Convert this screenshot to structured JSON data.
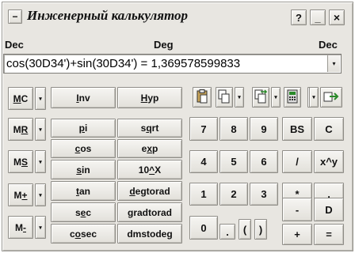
{
  "window": {
    "menu_glyph": "−",
    "title": "Инженерный калькулятор",
    "help_glyph": "?",
    "minimize_glyph": "_",
    "close_glyph": "×"
  },
  "modes": {
    "left": "Dec",
    "center": "Deg",
    "right": "Dec"
  },
  "display": {
    "expression": "cos(30D34')+sin(30D34') = 1,369578599833",
    "dropdown_glyph": "▾"
  },
  "memory": {
    "arrow_glyph": "▾",
    "buttons": [
      {
        "id": "mc",
        "pre": "",
        "u": "M",
        "post": "C"
      },
      {
        "id": "mr",
        "pre": "M",
        "u": "R",
        "post": ""
      },
      {
        "id": "ms",
        "pre": "M",
        "u": "S",
        "post": ""
      },
      {
        "id": "m-plus",
        "pre": "M",
        "u": "+",
        "post": ""
      },
      {
        "id": "m-minus",
        "pre": "M",
        "u": "-",
        "post": ""
      }
    ]
  },
  "functions": [
    {
      "id": "inv",
      "pre": "",
      "u": "I",
      "post": "nv"
    },
    {
      "id": "hyp",
      "pre": "",
      "u": "H",
      "post": "yp"
    },
    {
      "id": "pi",
      "pre": "",
      "u": "p",
      "post": "i"
    },
    {
      "id": "sqrt",
      "pre": "s",
      "u": "q",
      "post": "rt"
    },
    {
      "id": "cos",
      "pre": "",
      "u": "c",
      "post": "os"
    },
    {
      "id": "exp",
      "pre": "e",
      "u": "x",
      "post": "p"
    },
    {
      "id": "sin",
      "pre": "",
      "u": "s",
      "post": "in"
    },
    {
      "id": "pow10",
      "pre": "10",
      "u": "^",
      "post": "X"
    },
    {
      "id": "tan",
      "pre": "",
      "u": "t",
      "post": "an"
    },
    {
      "id": "degtorad",
      "pre": "",
      "u": "d",
      "post": "egtorad"
    },
    {
      "id": "sec",
      "pre": "s",
      "u": "e",
      "post": "c"
    },
    {
      "id": "gradtorad",
      "pre": "",
      "u": "g",
      "post": "radtorad"
    },
    {
      "id": "cosec",
      "pre": "c",
      "u": "o",
      "post": "sec"
    },
    {
      "id": "dmstodeg",
      "pre": "dmstode",
      "u": "g",
      "post": ""
    }
  ],
  "toolbar": {
    "arrow_glyph": "▾",
    "icons": [
      "paste-icon",
      "copy-icon",
      "copy-export-icon",
      "calculator-icon",
      "exit-icon"
    ]
  },
  "keypad": [
    {
      "id": "7",
      "label": "7"
    },
    {
      "id": "8",
      "label": "8"
    },
    {
      "id": "9",
      "label": "9"
    },
    {
      "id": "bs",
      "label": "BS"
    },
    {
      "id": "c",
      "label": "C"
    },
    {
      "id": "4",
      "label": "4"
    },
    {
      "id": "5",
      "label": "5"
    },
    {
      "id": "6",
      "label": "6"
    },
    {
      "id": "divide",
      "label": "/"
    },
    {
      "id": "power",
      "label": "x^y"
    },
    {
      "id": "1",
      "label": "1"
    },
    {
      "id": "2",
      "label": "2"
    },
    {
      "id": "3",
      "label": "3"
    },
    {
      "id": "multiply",
      "label": "*"
    },
    {
      "id": "comma",
      "label": ","
    },
    {
      "id": "0",
      "label": "0"
    },
    {
      "id": "dot",
      "label": "."
    },
    {
      "id": "lparen",
      "label": "("
    },
    {
      "id": "rparen",
      "label": ")"
    },
    {
      "id": "minus",
      "label": "-"
    },
    {
      "id": "d",
      "label": "D"
    },
    {
      "id": "plus",
      "label": "+"
    },
    {
      "id": "equals",
      "label": "="
    }
  ]
}
